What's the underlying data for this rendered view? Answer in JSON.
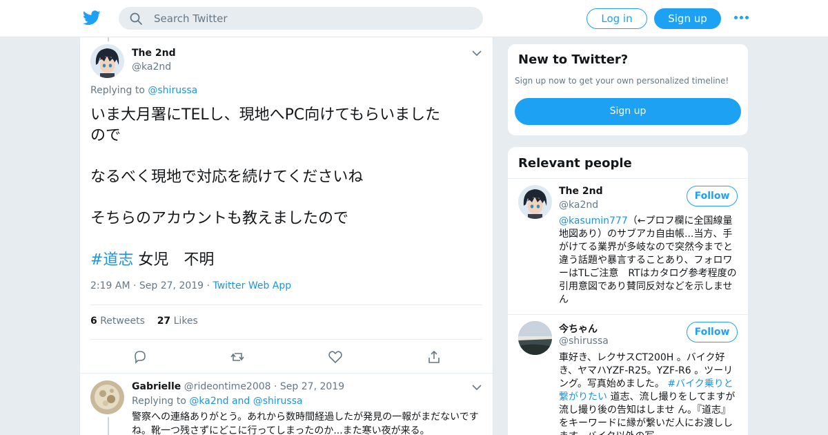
{
  "header": {
    "search_placeholder": "Search Twitter",
    "login_label": "Log in",
    "signup_label": "Sign up",
    "brand_color": "#1da1f2",
    "icons": [
      "twitter-bird-icon",
      "search-icon",
      "more-dots-icon"
    ]
  },
  "tweet": {
    "author_name": "The 2nd",
    "author_handle": "@ka2nd",
    "replying_label": "Replying to",
    "replying_handle": "@shirussa",
    "lines": [
      "いま大月署にTELし、現地へPC向けてもらいました",
      "ので",
      "なるべく現地で対応を続けてくださいね",
      "そちらのアカウントも教えましたので"
    ],
    "hashtag": "#道志",
    "tail": " 女児　不明",
    "time": "2:19 AM",
    "date": "Sep 27, 2019",
    "source": "Twitter Web App",
    "retweet_count": "6",
    "retweet_label": "Retweets",
    "like_count": "27",
    "like_label": "Likes"
  },
  "reply": {
    "name": "Gabrielle",
    "handle": "@rideontime2008",
    "date": "Sep 27, 2019",
    "replying_label": "Replying to",
    "replying_handles": "@ka2nd and @shirussa",
    "text": "警察への連絡ありがとう。あれから数時間経過したが発見の一報がまだないですね。靴一つ残さずにどこに行ってしまったのか...また寒い夜が来る。"
  },
  "sidebar": {
    "new_title": "New to Twitter?",
    "new_subtitle": "Sign up now to get your own personalized timeline!",
    "new_button": "Sign up",
    "relevant_title": "Relevant people",
    "people": [
      {
        "name": "The 2nd",
        "handle": "@ka2nd",
        "follow_label": "Follow",
        "bio_link": "@kasumin777",
        "bio": "（←プロフ欄に全国線量地図あり）のサブアカ自由帳...当方、手がけてる業界が多岐なので突然今までと違う話題や暴言することあり、フォロワーはTLご注意　RTはカタログ参考程度の引用意図であり賛同反対などを示しません"
      },
      {
        "name": "今ちゃん",
        "handle": "@shirussa",
        "follow_label": "Follow",
        "bio_before": "車好き、レクサスCT200H 。バイク好き、ヤマハYZF-R25。YZF-R6 。ツーリング。写真始めました。",
        "bio_link": "#バイク乗りと繋がりたい",
        "bio_after": "道志、流し撮りをしてますが流し撮り後の告知はしませ ん。『道志』をキーワードに縁が繋いだ人にお渡しします。バイク以外の写"
      }
    ]
  }
}
